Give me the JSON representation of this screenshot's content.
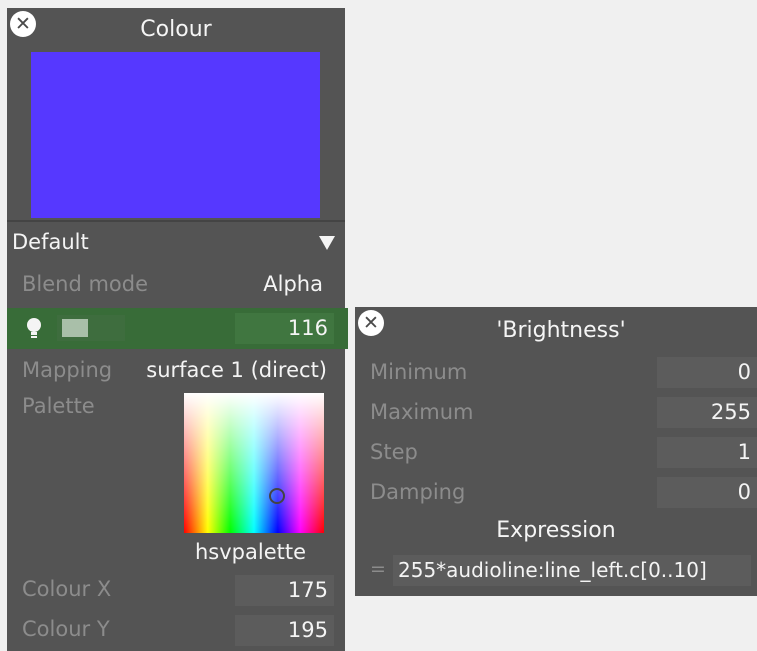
{
  "colour_panel": {
    "title": "Colour",
    "swatch_color": "#5638ff",
    "preset": "Default",
    "blend_mode": {
      "label": "Blend mode",
      "value": "Alpha"
    },
    "brightness": {
      "value": "116",
      "fraction": 0.455
    },
    "mapping": {
      "label": "Mapping",
      "value": "surface 1 (direct)"
    },
    "palette": {
      "label": "Palette",
      "name": "hsvpalette"
    },
    "colour_x": {
      "label": "Colour X",
      "value": "175"
    },
    "colour_y": {
      "label": "Colour Y",
      "value": "195"
    }
  },
  "brightness_panel": {
    "title": "'Brightness'",
    "minimum": {
      "label": "Minimum",
      "value": "0"
    },
    "maximum": {
      "label": "Maximum",
      "value": "255"
    },
    "step": {
      "label": "Step",
      "value": "1"
    },
    "damping": {
      "label": "Damping",
      "value": "0"
    },
    "expression": {
      "heading": "Expression",
      "prefix": "=",
      "value": "255*audioline:line_left.c[0..10]"
    }
  },
  "colors": {
    "active_row": "#386c38",
    "panel_bg": "#545454"
  },
  "icons": {
    "close": "close-icon",
    "brightness": "lightbulb-icon",
    "dropdown": "dropdown-triangle-icon"
  }
}
